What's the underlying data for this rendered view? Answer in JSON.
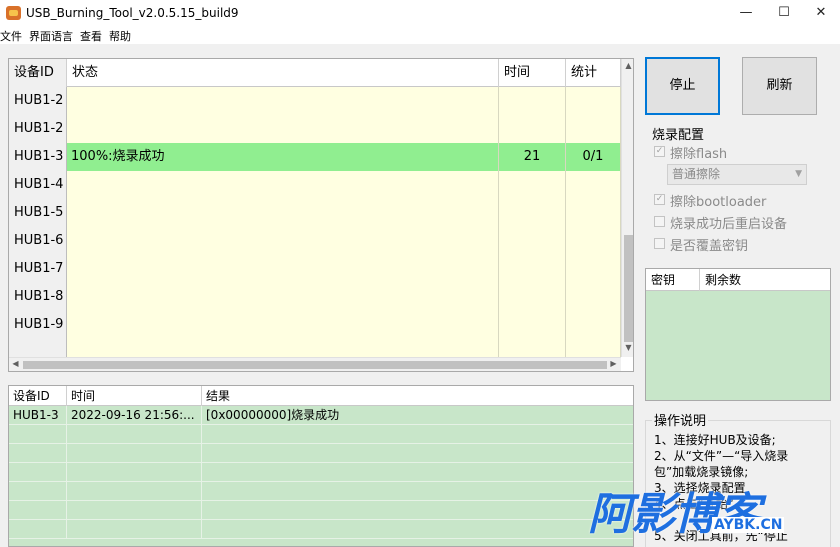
{
  "window": {
    "title": "USB_Burning_Tool_v2.0.5.15_build9",
    "minimize": "—",
    "maximize": "☐",
    "close": "✕"
  },
  "menu": [
    "文件",
    "界面语言",
    "查看",
    "帮助"
  ],
  "device_grid": {
    "headers": [
      "设备ID",
      "状态",
      "时间",
      "统计"
    ],
    "rows": [
      {
        "id": "HUB1-2",
        "status": "",
        "time": "",
        "count": "",
        "success": false
      },
      {
        "id": "HUB1-2",
        "status": "",
        "time": "",
        "count": "",
        "success": false
      },
      {
        "id": "HUB1-3",
        "status": "100%:烧录成功",
        "time": "21",
        "count": "0/1",
        "success": true
      },
      {
        "id": "HUB1-4",
        "status": "",
        "time": "",
        "count": "",
        "success": false
      },
      {
        "id": "HUB1-5",
        "status": "",
        "time": "",
        "count": "",
        "success": false
      },
      {
        "id": "HUB1-6",
        "status": "",
        "time": "",
        "count": "",
        "success": false
      },
      {
        "id": "HUB1-7",
        "status": "",
        "time": "",
        "count": "",
        "success": false
      },
      {
        "id": "HUB1-8",
        "status": "",
        "time": "",
        "count": "",
        "success": false
      },
      {
        "id": "HUB1-9",
        "status": "",
        "time": "",
        "count": "",
        "success": false
      }
    ]
  },
  "log_grid": {
    "headers": [
      "设备ID",
      "时间",
      "结果"
    ],
    "rows": [
      {
        "id": "HUB1-3",
        "time": "2022-09-16 21:56:...",
        "result": "[0x00000000]烧录成功"
      }
    ]
  },
  "buttons": {
    "stop": "停止",
    "refresh": "刷新"
  },
  "burn_config": {
    "title": "烧录配置",
    "erase_flash": "擦除flash",
    "erase_mode": "普通擦除",
    "erase_bootloader": "擦除bootloader",
    "reboot_after": "烧录成功后重启设备",
    "overwrite_key": "是否覆盖密钥"
  },
  "key_table": {
    "headers": [
      "密钥",
      "剩余数"
    ]
  },
  "help": {
    "title": "操作说明",
    "lines": [
      "1、连接好HUB及设备;",
      "2、从“文件”—“导入烧录",
      "包”加载烧录镜像;",
      "3、选择烧录配置",
      "4、点击“开始”",
      "5、关闭工具前，先“停止"
    ]
  },
  "watermark": {
    "main": "阿影博客",
    "sub": "AYBK.CN"
  },
  "colors": {
    "success_row": "#90ee90",
    "idle_row": "#ffffe1",
    "log_bg": "#c8e6c9",
    "watermark": "#1e6fe0"
  }
}
